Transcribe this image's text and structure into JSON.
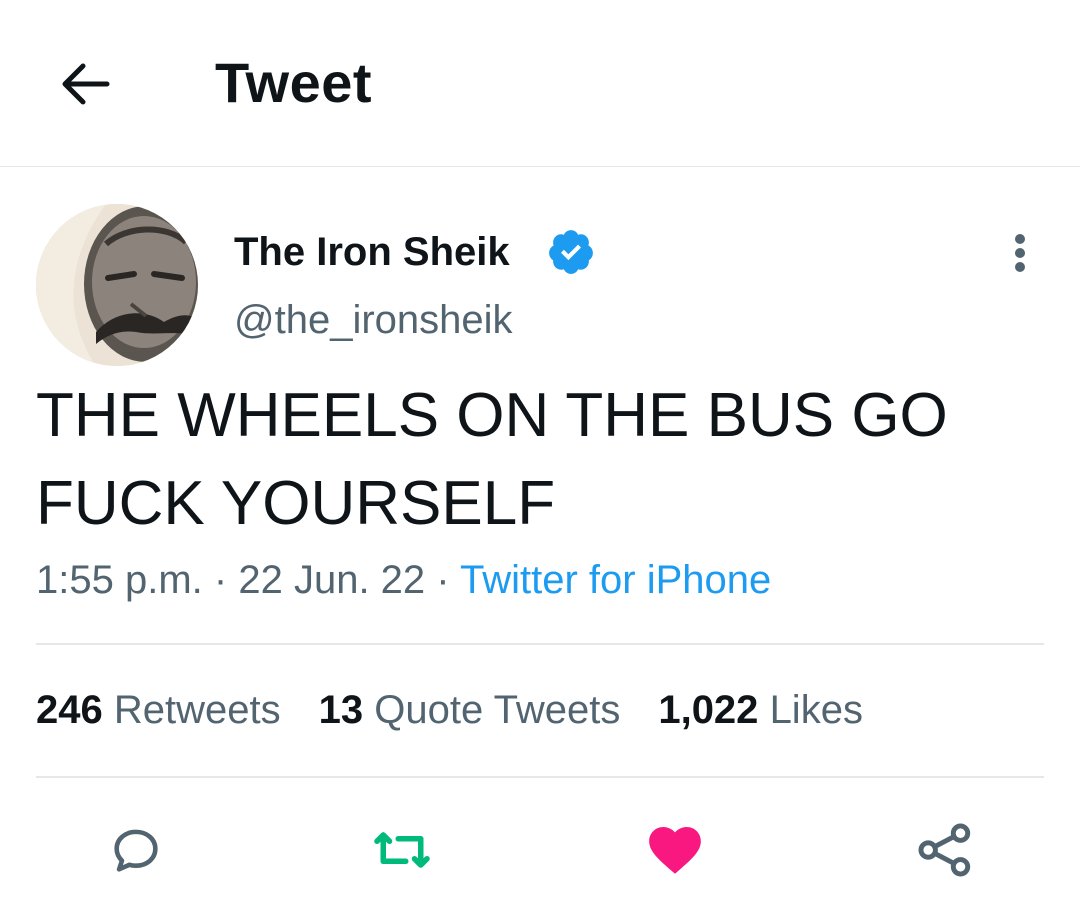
{
  "header": {
    "title": "Tweet",
    "back_icon": "arrow-left-icon"
  },
  "tweet": {
    "author": {
      "name": "The Iron Sheik",
      "handle": "@the_ironsheik",
      "verified_icon": "verified-badge-icon",
      "verified_color": "#1d9bf0"
    },
    "text": "THE WHEELS ON THE BUS GO FUCK YOURSELF",
    "time": "1:55 p.m.",
    "date": "22 Jun. 22",
    "separator": "·",
    "source": "Twitter for iPhone",
    "stats": {
      "retweets_count": "246",
      "retweets_label": "Retweets",
      "quotes_count": "13",
      "quotes_label": "Quote Tweets",
      "likes_count": "1,022",
      "likes_label": "Likes"
    },
    "actions": {
      "reply_icon": "reply-icon",
      "retweet_icon": "retweet-icon",
      "like_icon": "heart-icon",
      "share_icon": "share-icon"
    }
  },
  "colors": {
    "text_primary": "#0f1419",
    "text_secondary": "#536471",
    "link": "#1d9bf0",
    "retweet_active": "#00ba7c",
    "like_active": "#f91880",
    "divider": "#e4e8eb"
  }
}
